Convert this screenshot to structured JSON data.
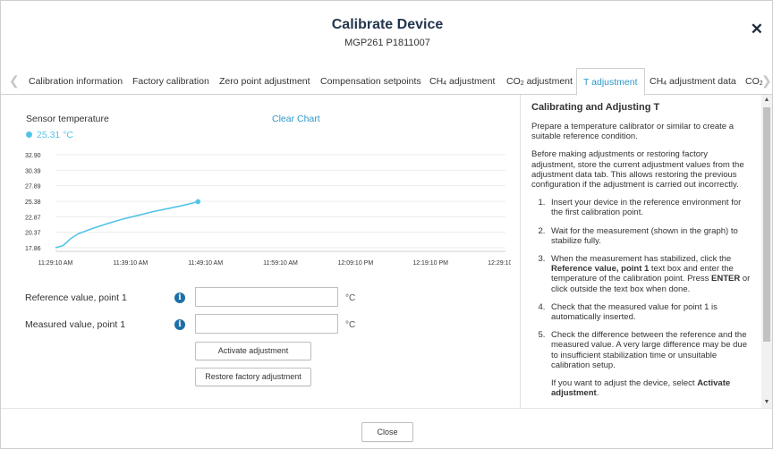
{
  "dialog": {
    "title": "Calibrate Device",
    "subtitle": "MGP261 P1811007",
    "close_icon": "close-icon"
  },
  "tabs": [
    {
      "label": "Calibration information",
      "sub": "",
      "suffix": ""
    },
    {
      "label": "Factory calibration",
      "sub": "",
      "suffix": ""
    },
    {
      "label": "Zero point adjustment",
      "sub": "",
      "suffix": ""
    },
    {
      "label": "Compensation setpoints",
      "sub": "",
      "suffix": ""
    },
    {
      "label": "CH",
      "sub": "4",
      "suffix": " adjustment"
    },
    {
      "label": "CO",
      "sub": "2",
      "suffix": " adjustment"
    },
    {
      "label": "T adjustment",
      "sub": "",
      "suffix": "",
      "active": true
    },
    {
      "label": "CH",
      "sub": "4",
      "suffix": " adjustment data"
    },
    {
      "label": "CO",
      "sub": "2",
      "suffix": ""
    }
  ],
  "chart_panel": {
    "sensor_label": "Sensor temperature",
    "sensor_value": "25.31 °C",
    "clear_chart": "Clear Chart"
  },
  "chart_data": {
    "type": "line",
    "series": [
      {
        "color": "#53c4e8",
        "x": [
          "11:29:10 AM",
          "11:30:10 AM",
          "11:31:10 AM",
          "11:32:10 AM",
          "11:34:10 AM",
          "11:36:10 AM",
          "11:38:10 AM",
          "11:40:10 AM",
          "11:42:10 AM",
          "11:44:10 AM",
          "11:46:10 AM",
          "11:48:10 AM"
        ],
        "y": [
          17.86,
          18.2,
          19.3,
          20.1,
          21.0,
          21.8,
          22.5,
          23.1,
          23.7,
          24.2,
          24.7,
          25.31
        ]
      }
    ],
    "yticks": [
      32.9,
      30.39,
      27.89,
      25.38,
      22.87,
      20.37,
      17.86
    ],
    "xticks": [
      "11:29:10 AM",
      "11:39:10 AM",
      "11:49:10 AM",
      "11:59:10 AM",
      "12:09:10 PM",
      "12:19:10 PM",
      "12:29:10 PM"
    ],
    "ylim": [
      17.86,
      32.9
    ],
    "xlim": [
      "11:29:10 AM",
      "12:29:10 PM"
    ],
    "grid": true,
    "end_marker": true
  },
  "form": {
    "reference_label": "Reference value, point 1",
    "reference_value": "",
    "measured_label": "Measured value, point 1",
    "measured_value": "",
    "unit": "°C",
    "info_icon": "info-icon",
    "activate_button": "Activate adjustment",
    "restore_button": "Restore factory adjustment"
  },
  "help": {
    "title": "Calibrating and Adjusting T",
    "p1": "Prepare a temperature calibrator or similar to create a suitable reference condition.",
    "p2": "Before making adjustments or restoring factory adjustment, store the current adjustment values from the adjustment data tab. This allows restoring the previous configuration if the adjustment is carried out incorrectly.",
    "step1": "Insert your device in the reference environment for the first calibration point.",
    "step2": "Wait for the measurement (shown in the graph) to stabilize fully.",
    "step3_a": "When the measurement has stabilized, click the ",
    "step3_b": "Reference value, point 1",
    "step3_c": " text box and enter the temperature of the calibration point. Press ",
    "step3_d": "ENTER",
    "step3_e": " or click outside the text box when done.",
    "step4": "Check that the measured value for point 1 is automatically inserted.",
    "step5": "Check the difference between the reference and the measured value. A very large difference may be due to insufficient stabilization time or unsuitable calibration setup.",
    "step5b_a": "If you want to adjust the device, select ",
    "step5b_b": "Activate adjustment",
    "step5b_c": "."
  },
  "footer": {
    "close_button": "Close"
  }
}
